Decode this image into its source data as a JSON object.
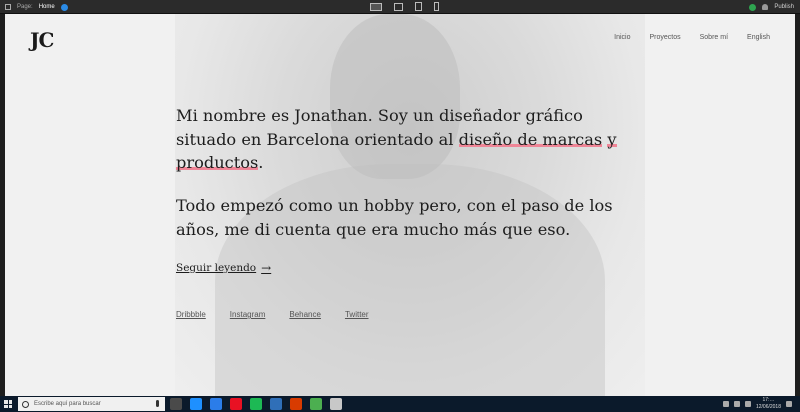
{
  "editor_bar": {
    "page_label": "Page:",
    "page_value": "Home",
    "user": "Publish"
  },
  "site": {
    "logo": "JC",
    "nav": [
      "Inicio",
      "Proyectos",
      "Sobre mí",
      "English"
    ],
    "intro": {
      "before": "Mi nombre es Jonathan. Soy un diseñador gráfico situado en Barcelona orientado al ",
      "highlight1": "diseño de marcas",
      "between": " ",
      "highlight2": "y productos",
      "after": "."
    },
    "intro2": "Todo empezó como un hobby pero, con el paso de los años, me di cuenta que era mucho más que eso.",
    "more_link": "Seguir leyendo",
    "more_arrow": "→",
    "socials": [
      "Dribbble",
      "Instagram",
      "Behance",
      "Twitter"
    ],
    "highlight_color": "#ef8596"
  },
  "taskbar": {
    "search_placeholder": "Escribe aquí para buscar",
    "time": "17:…",
    "date": "12/06/2018",
    "app_colors": [
      "#4a4a4a",
      "#1e90ff",
      "#2b7de9",
      "#e81123",
      "#1db954",
      "#2f6fb8",
      "#d83b01",
      "#4caf50",
      "#c8c8c8"
    ]
  }
}
